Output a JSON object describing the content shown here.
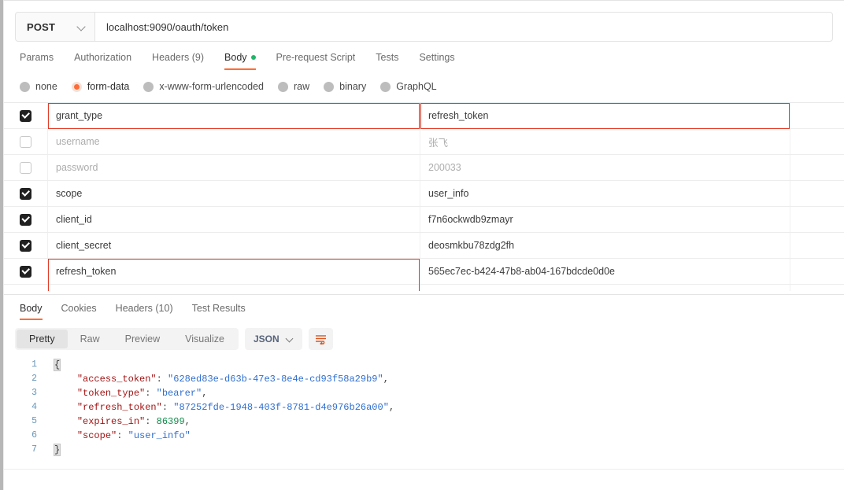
{
  "request": {
    "method": "POST",
    "url": "localhost:9090/oauth/token",
    "tabs": [
      {
        "label": "Params",
        "active": false,
        "dot": false
      },
      {
        "label": "Authorization",
        "active": false,
        "dot": false
      },
      {
        "label": "Headers (9)",
        "active": false,
        "dot": false
      },
      {
        "label": "Body",
        "active": true,
        "dot": true
      },
      {
        "label": "Pre-request Script",
        "active": false,
        "dot": false
      },
      {
        "label": "Tests",
        "active": false,
        "dot": false
      },
      {
        "label": "Settings",
        "active": false,
        "dot": false
      }
    ],
    "body_types": [
      {
        "label": "none",
        "selected": false
      },
      {
        "label": "form-data",
        "selected": true
      },
      {
        "label": "x-www-form-urlencoded",
        "selected": false
      },
      {
        "label": "raw",
        "selected": false
      },
      {
        "label": "binary",
        "selected": false
      },
      {
        "label": "GraphQL",
        "selected": false
      }
    ],
    "form_data": [
      {
        "checked": true,
        "key": "grant_type",
        "value": "refresh_token",
        "muted": false,
        "key_highlight": false,
        "value_highlight": true
      },
      {
        "checked": false,
        "key": "username",
        "value": "张飞",
        "muted": true,
        "key_highlight": false,
        "value_highlight": false
      },
      {
        "checked": false,
        "key": "password",
        "value": "200033",
        "muted": true,
        "key_highlight": false,
        "value_highlight": false
      },
      {
        "checked": true,
        "key": "scope",
        "value": "user_info",
        "muted": false,
        "key_highlight": false,
        "value_highlight": false
      },
      {
        "checked": true,
        "key": "client_id",
        "value": "f7n6ockwdb9zmayr",
        "muted": false,
        "key_highlight": false,
        "value_highlight": false
      },
      {
        "checked": true,
        "key": "client_secret",
        "value": "deosmkbu78zdg2fh",
        "muted": false,
        "key_highlight": false,
        "value_highlight": false
      },
      {
        "checked": true,
        "key": "refresh_token",
        "value": "565ec7ec-b424-47b8-ab04-167bdcde0d0e",
        "muted": false,
        "key_highlight": true,
        "value_highlight": false
      }
    ]
  },
  "response": {
    "tabs": [
      {
        "label": "Body",
        "active": true
      },
      {
        "label": "Cookies",
        "active": false
      },
      {
        "label": "Headers (10)",
        "active": false
      },
      {
        "label": "Test Results",
        "active": false
      }
    ],
    "formats": [
      {
        "label": "Pretty",
        "active": true
      },
      {
        "label": "Raw",
        "active": false
      },
      {
        "label": "Preview",
        "active": false
      },
      {
        "label": "Visualize",
        "active": false
      }
    ],
    "language": "JSON",
    "wrap_icon": "word-wrap-icon",
    "body_lines": [
      {
        "n": "1",
        "tokens": [
          {
            "t": "{",
            "c": "brace-hl"
          }
        ]
      },
      {
        "n": "2",
        "tokens": [
          {
            "t": "    ",
            "c": "p"
          },
          {
            "t": "\"access_token\"",
            "c": "k"
          },
          {
            "t": ": ",
            "c": "p"
          },
          {
            "t": "\"628ed83e-d63b-47e3-8e4e-cd93f58a29b9\"",
            "c": "s"
          },
          {
            "t": ",",
            "c": "p"
          }
        ]
      },
      {
        "n": "3",
        "tokens": [
          {
            "t": "    ",
            "c": "p"
          },
          {
            "t": "\"token_type\"",
            "c": "k"
          },
          {
            "t": ": ",
            "c": "p"
          },
          {
            "t": "\"bearer\"",
            "c": "s"
          },
          {
            "t": ",",
            "c": "p"
          }
        ]
      },
      {
        "n": "4",
        "tokens": [
          {
            "t": "    ",
            "c": "p"
          },
          {
            "t": "\"refresh_token\"",
            "c": "k"
          },
          {
            "t": ": ",
            "c": "p"
          },
          {
            "t": "\"87252fde-1948-403f-8781-d4e976b26a00\"",
            "c": "s"
          },
          {
            "t": ",",
            "c": "p"
          }
        ]
      },
      {
        "n": "5",
        "tokens": [
          {
            "t": "    ",
            "c": "p"
          },
          {
            "t": "\"expires_in\"",
            "c": "k"
          },
          {
            "t": ": ",
            "c": "p"
          },
          {
            "t": "86399",
            "c": "n"
          },
          {
            "t": ",",
            "c": "p"
          }
        ]
      },
      {
        "n": "6",
        "tokens": [
          {
            "t": "    ",
            "c": "p"
          },
          {
            "t": "\"scope\"",
            "c": "k"
          },
          {
            "t": ": ",
            "c": "p"
          },
          {
            "t": "\"user_info\"",
            "c": "s"
          }
        ]
      },
      {
        "n": "7",
        "tokens": [
          {
            "t": "}",
            "c": "brace-hl"
          }
        ]
      }
    ],
    "json_values": {
      "access_token": "628ed83e-d63b-47e3-8e4e-cd93f58a29b9",
      "token_type": "bearer",
      "refresh_token": "87252fde-1948-403f-8781-d4e976b26a00",
      "expires_in": 86399,
      "scope": "user_info"
    }
  },
  "colors": {
    "accent": "#ff6c37",
    "highlight_border": "#e23b28",
    "body_dot": "#25b36b",
    "json_key": "#a31515",
    "json_string": "#2f6fd0",
    "json_number": "#0f8a4a"
  }
}
